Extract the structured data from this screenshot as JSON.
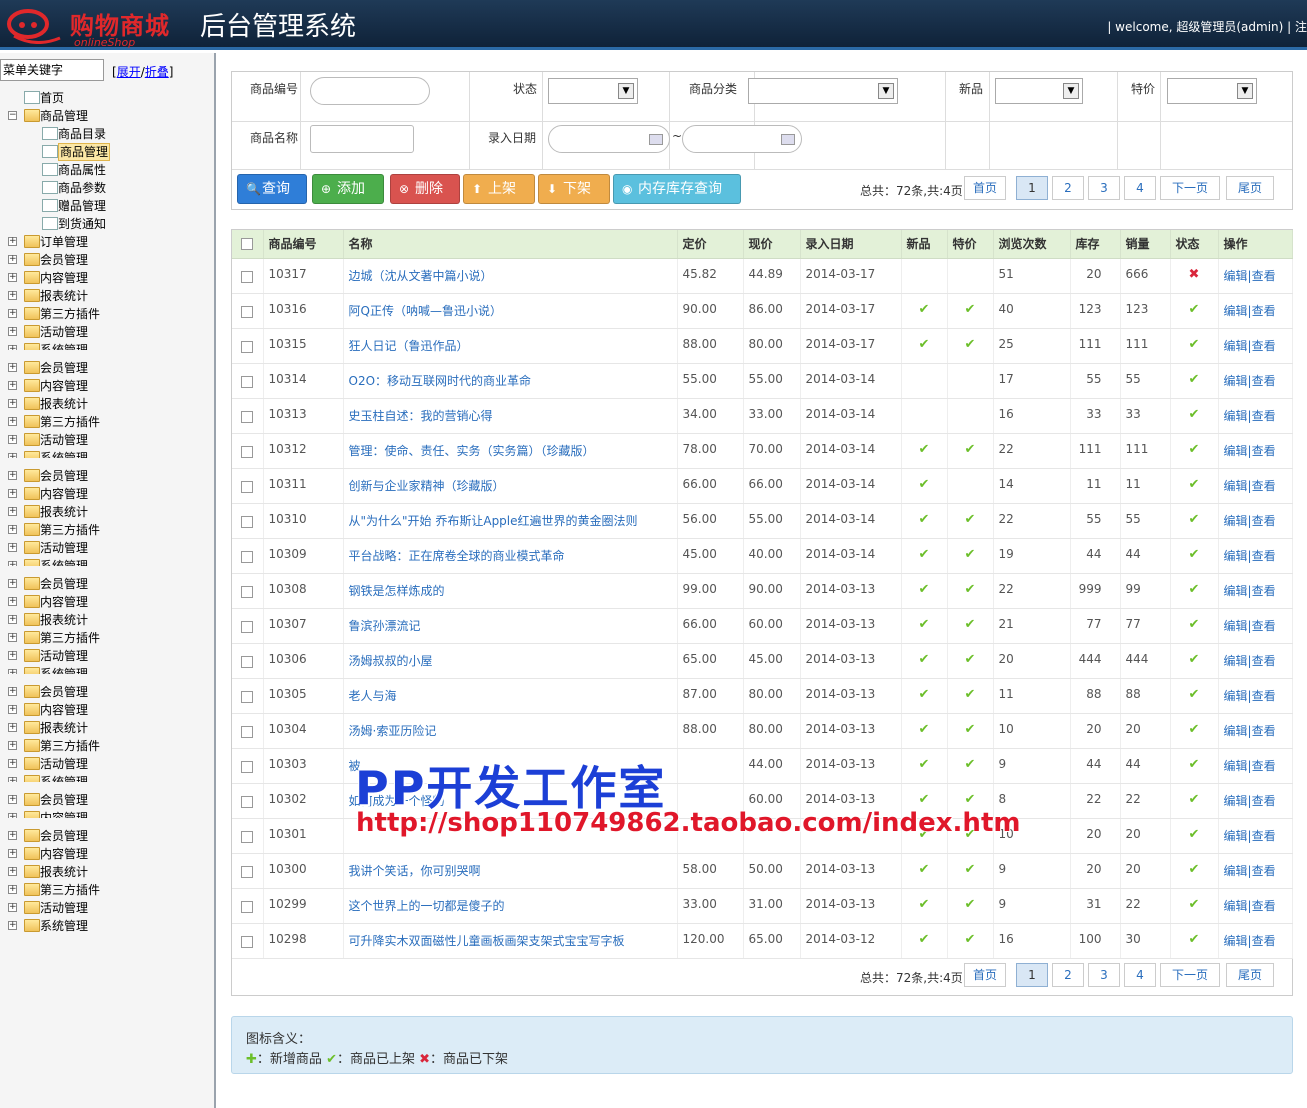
{
  "header": {
    "logo_cn": "购物商城",
    "logo_en": "onlineShop",
    "title": "后台管理系统",
    "welcome": "| welcome, 超级管理员(admin) | 注"
  },
  "sidebar": {
    "search_value": "菜单关键字",
    "toggle_open": "展开",
    "toggle_sep": "/",
    "toggle_close": "折叠",
    "items": [
      {
        "label": "首页",
        "level": 1,
        "type": "page"
      },
      {
        "label": "商品管理",
        "level": 0,
        "type": "folder",
        "pm": "−"
      },
      {
        "label": "商品目录",
        "level": 2,
        "type": "page"
      },
      {
        "label": "商品管理",
        "level": 2,
        "type": "page",
        "selected": true
      },
      {
        "label": "商品属性",
        "level": 2,
        "type": "page"
      },
      {
        "label": "商品参数",
        "level": 2,
        "type": "page"
      },
      {
        "label": "赠品管理",
        "level": 2,
        "type": "page"
      },
      {
        "label": "到货通知",
        "level": 2,
        "type": "page"
      },
      {
        "label": "订单管理",
        "level": 0,
        "type": "folder",
        "pm": "+"
      },
      {
        "label": "会员管理",
        "level": 0,
        "type": "folder",
        "pm": "+"
      },
      {
        "label": "内容管理",
        "level": 0,
        "type": "folder",
        "pm": "+"
      },
      {
        "label": "报表统计",
        "level": 0,
        "type": "folder",
        "pm": "+"
      },
      {
        "label": "第三方插件",
        "level": 0,
        "type": "folder",
        "pm": "+"
      },
      {
        "label": "活动管理",
        "level": 0,
        "type": "folder",
        "pm": "+"
      },
      {
        "label": "系统管理",
        "level": 0,
        "type": "folder",
        "pm": "+",
        "clipped": true
      },
      {
        "label": "会员管理",
        "level": 0,
        "type": "folder",
        "pm": "+"
      },
      {
        "label": "内容管理",
        "level": 0,
        "type": "folder",
        "pm": "+"
      },
      {
        "label": "报表统计",
        "level": 0,
        "type": "folder",
        "pm": "+"
      },
      {
        "label": "第三方插件",
        "level": 0,
        "type": "folder",
        "pm": "+"
      },
      {
        "label": "活动管理",
        "level": 0,
        "type": "folder",
        "pm": "+"
      },
      {
        "label": "系统管理",
        "level": 0,
        "type": "folder",
        "pm": "+",
        "clipped": true
      },
      {
        "label": "会员管理",
        "level": 0,
        "type": "folder",
        "pm": "+"
      },
      {
        "label": "内容管理",
        "level": 0,
        "type": "folder",
        "pm": "+"
      },
      {
        "label": "报表统计",
        "level": 0,
        "type": "folder",
        "pm": "+"
      },
      {
        "label": "第三方插件",
        "level": 0,
        "type": "folder",
        "pm": "+"
      },
      {
        "label": "活动管理",
        "level": 0,
        "type": "folder",
        "pm": "+"
      },
      {
        "label": "系统管理",
        "level": 0,
        "type": "folder",
        "pm": "+",
        "clipped": true
      },
      {
        "label": "会员管理",
        "level": 0,
        "type": "folder",
        "pm": "+"
      },
      {
        "label": "内容管理",
        "level": 0,
        "type": "folder",
        "pm": "+"
      },
      {
        "label": "报表统计",
        "level": 0,
        "type": "folder",
        "pm": "+"
      },
      {
        "label": "第三方插件",
        "level": 0,
        "type": "folder",
        "pm": "+"
      },
      {
        "label": "活动管理",
        "level": 0,
        "type": "folder",
        "pm": "+"
      },
      {
        "label": "系统管理",
        "level": 0,
        "type": "folder",
        "pm": "+",
        "clipped": true
      },
      {
        "label": "会员管理",
        "level": 0,
        "type": "folder",
        "pm": "+"
      },
      {
        "label": "内容管理",
        "level": 0,
        "type": "folder",
        "pm": "+"
      },
      {
        "label": "报表统计",
        "level": 0,
        "type": "folder",
        "pm": "+"
      },
      {
        "label": "第三方插件",
        "level": 0,
        "type": "folder",
        "pm": "+"
      },
      {
        "label": "活动管理",
        "level": 0,
        "type": "folder",
        "pm": "+"
      },
      {
        "label": "系统管理",
        "level": 0,
        "type": "folder",
        "pm": "+",
        "clipped": true
      },
      {
        "label": "会员管理",
        "level": 0,
        "type": "folder",
        "pm": "+"
      },
      {
        "label": "内容管理",
        "level": 0,
        "type": "folder",
        "pm": "+",
        "clipped": true
      },
      {
        "label": "会员管理",
        "level": 0,
        "type": "folder",
        "pm": "+"
      },
      {
        "label": "内容管理",
        "level": 0,
        "type": "folder",
        "pm": "+"
      },
      {
        "label": "报表统计",
        "level": 0,
        "type": "folder",
        "pm": "+"
      },
      {
        "label": "第三方插件",
        "level": 0,
        "type": "folder",
        "pm": "+"
      },
      {
        "label": "活动管理",
        "level": 0,
        "type": "folder",
        "pm": "+"
      },
      {
        "label": "系统管理",
        "level": 0,
        "type": "folder",
        "pm": "+"
      }
    ]
  },
  "filter": {
    "code_label": "商品编号",
    "status_label": "状态",
    "category_label": "商品分类",
    "new_label": "新品",
    "special_label": "特价",
    "name_label": "商品名称",
    "date_label": "录入日期",
    "date_sep": "~",
    "buttons": {
      "query": "查询",
      "add": "添加",
      "delete": "删除",
      "shelve": "上架",
      "unshelve": "下架",
      "stock": "内存库存查询"
    }
  },
  "pager": {
    "info": "总共：72条,共:4页",
    "first": "首页",
    "pages": [
      "1",
      "2",
      "3",
      "4"
    ],
    "current": "1",
    "next": "下一页",
    "last": "尾页"
  },
  "table": {
    "columns": [
      "商品编号",
      "名称",
      "定价",
      "现价",
      "录入日期",
      "新品",
      "特价",
      "浏览次数",
      "库存",
      "销量",
      "状态",
      "操作"
    ],
    "edit_label": "编辑",
    "op_sep": "|",
    "view_label": "查看",
    "check_mark": "✔",
    "cross_mark": "✖",
    "rows": [
      {
        "id": "10317",
        "name": "边城（沈从文著中篇小说）",
        "list": "45.82",
        "price": "44.89",
        "date": "2014-03-17",
        "new": false,
        "special": false,
        "views": "51",
        "stock": "20",
        "sales": "666",
        "status": false
      },
      {
        "id": "10316",
        "name": "阿Q正传（呐喊—鲁迅小说）",
        "list": "90.00",
        "price": "86.00",
        "date": "2014-03-17",
        "new": true,
        "special": true,
        "views": "40",
        "stock": "123",
        "sales": "123",
        "status": true
      },
      {
        "id": "10315",
        "name": "狂人日记（鲁迅作品）",
        "list": "88.00",
        "price": "80.00",
        "date": "2014-03-17",
        "new": true,
        "special": true,
        "views": "25",
        "stock": "111",
        "sales": "111",
        "status": true
      },
      {
        "id": "10314",
        "name": "O2O：移动互联网时代的商业革命",
        "list": "55.00",
        "price": "55.00",
        "date": "2014-03-14",
        "new": false,
        "special": false,
        "views": "17",
        "stock": "55",
        "sales": "55",
        "status": true
      },
      {
        "id": "10313",
        "name": "史玉柱自述：我的营销心得",
        "list": "34.00",
        "price": "33.00",
        "date": "2014-03-14",
        "new": false,
        "special": false,
        "views": "16",
        "stock": "33",
        "sales": "33",
        "status": true
      },
      {
        "id": "10312",
        "name": "管理：使命、责任、实务（实务篇）（珍藏版）",
        "list": "78.00",
        "price": "70.00",
        "date": "2014-03-14",
        "new": true,
        "special": true,
        "views": "22",
        "stock": "111",
        "sales": "111",
        "status": true
      },
      {
        "id": "10311",
        "name": "创新与企业家精神（珍藏版）",
        "list": "66.00",
        "price": "66.00",
        "date": "2014-03-14",
        "new": true,
        "special": false,
        "views": "14",
        "stock": "11",
        "sales": "11",
        "status": true
      },
      {
        "id": "10310",
        "name": "从\"为什么\"开始 乔布斯让Apple红遍世界的黄金圈法则",
        "list": "56.00",
        "price": "55.00",
        "date": "2014-03-14",
        "new": true,
        "special": true,
        "views": "22",
        "stock": "55",
        "sales": "55",
        "status": true
      },
      {
        "id": "10309",
        "name": "平台战略：正在席卷全球的商业模式革命",
        "list": "45.00",
        "price": "40.00",
        "date": "2014-03-14",
        "new": true,
        "special": true,
        "views": "19",
        "stock": "44",
        "sales": "44",
        "status": true
      },
      {
        "id": "10308",
        "name": "钢铁是怎样炼成的",
        "list": "99.00",
        "price": "90.00",
        "date": "2014-03-13",
        "new": true,
        "special": true,
        "views": "22",
        "stock": "999",
        "sales": "99",
        "status": true
      },
      {
        "id": "10307",
        "name": "鲁滨孙漂流记",
        "list": "66.00",
        "price": "60.00",
        "date": "2014-03-13",
        "new": true,
        "special": true,
        "views": "21",
        "stock": "77",
        "sales": "77",
        "status": true
      },
      {
        "id": "10306",
        "name": "汤姆叔叔的小屋",
        "list": "65.00",
        "price": "45.00",
        "date": "2014-03-13",
        "new": true,
        "special": true,
        "views": "20",
        "stock": "444",
        "sales": "444",
        "status": true
      },
      {
        "id": "10305",
        "name": "老人与海",
        "list": "87.00",
        "price": "80.00",
        "date": "2014-03-13",
        "new": true,
        "special": true,
        "views": "11",
        "stock": "88",
        "sales": "88",
        "status": true
      },
      {
        "id": "10304",
        "name": "汤姆·索亚历险记",
        "list": "88.00",
        "price": "80.00",
        "date": "2014-03-13",
        "new": true,
        "special": true,
        "views": "10",
        "stock": "20",
        "sales": "20",
        "status": true
      },
      {
        "id": "10303",
        "name": "被",
        "list": "",
        "price": "44.00",
        "date": "2014-03-13",
        "new": true,
        "special": true,
        "views": "9",
        "stock": "44",
        "sales": "44",
        "status": true
      },
      {
        "id": "10302",
        "name": "如何成为一个怪物",
        "list": "",
        "price": "60.00",
        "date": "2014-03-13",
        "new": true,
        "special": true,
        "views": "8",
        "stock": "22",
        "sales": "22",
        "status": true
      },
      {
        "id": "10301",
        "name": "",
        "list": "",
        "price": "",
        "date": "",
        "new": true,
        "special": true,
        "views": "10",
        "stock": "20",
        "sales": "20",
        "status": true
      },
      {
        "id": "10300",
        "name": "我讲个笑话，你可别哭啊",
        "list": "58.00",
        "price": "50.00",
        "date": "2014-03-13",
        "new": true,
        "special": true,
        "views": "9",
        "stock": "20",
        "sales": "20",
        "status": true
      },
      {
        "id": "10299",
        "name": "这个世界上的一切都是傻子的",
        "list": "33.00",
        "price": "31.00",
        "date": "2014-03-13",
        "new": true,
        "special": true,
        "views": "9",
        "stock": "31",
        "sales": "22",
        "status": true
      },
      {
        "id": "10298",
        "name": "可升降实木双面磁性儿童画板画架支架式宝宝写字板",
        "list": "120.00",
        "price": "65.00",
        "date": "2014-03-12",
        "new": true,
        "special": true,
        "views": "16",
        "stock": "100",
        "sales": "30",
        "status": true
      }
    ]
  },
  "legend": {
    "title": "图标含义：",
    "plus_mark": "✚",
    "new_label": "：新增商品",
    "ok_mark": "✔",
    "on_label": "：商品已上架",
    "x_mark": "✖",
    "off_label": "：商品已下架"
  },
  "watermark": {
    "title": "PP开发工作室",
    "url": "http://shop110749862.taobao.com/index.htm"
  },
  "colors": {
    "header_bg": "#1f3a57",
    "accent_blue": "#2f7ed8",
    "check_green": "#6cbf2a",
    "cross_red": "#d9263b",
    "table_header": "#e3f1d8"
  }
}
